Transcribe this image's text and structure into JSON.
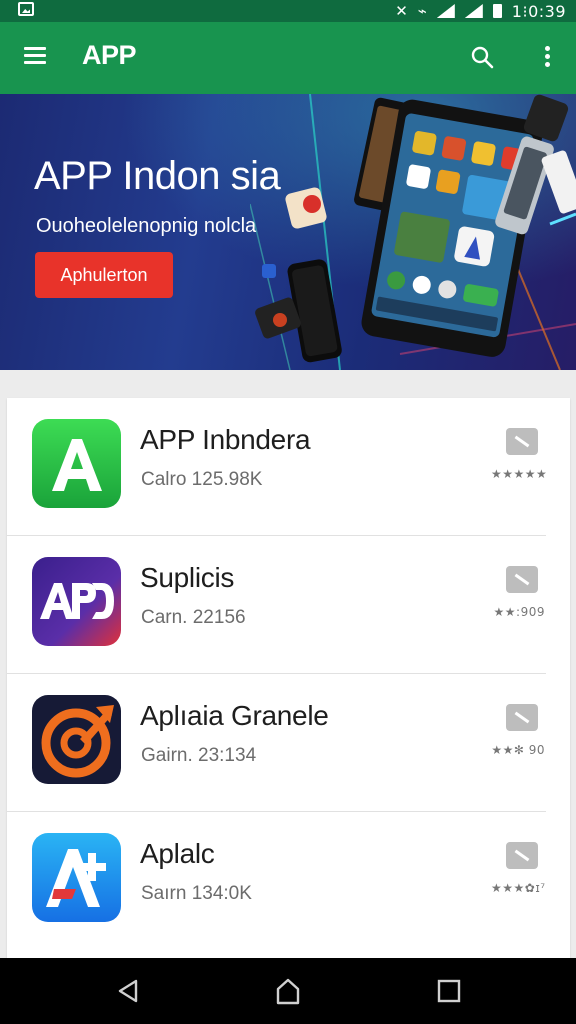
{
  "status_bar": {
    "time": "1⁝0:39"
  },
  "app_bar": {
    "title": "APP",
    "menu_icon": "menu-icon",
    "search_icon": "search-icon",
    "more_icon": "more-vert-icon"
  },
  "banner": {
    "title": "APP Indon sia",
    "subtitle": "Ouoheolelenopnig nolcla",
    "button_label": "Aphulerton",
    "button_color": "#e8332a"
  },
  "apps": [
    {
      "name": "APP Inbndera",
      "meta": "Calro 125.98K",
      "rating": "★★★★★",
      "icon": "letter-a-icon"
    },
    {
      "name": "Suplicis",
      "meta": "Carn. 22156",
      "rating": "★★:909",
      "icon": "apd-logo-icon"
    },
    {
      "name": "Aplıaia Granele",
      "meta": "Gairn. 23:134",
      "rating": "★★✻ 90",
      "icon": "target-icon"
    },
    {
      "name": "Aplalc",
      "meta": "Saırn 134:0K",
      "rating": "★★★✿ɪ⁷",
      "icon": "app-store-a-icon"
    }
  ],
  "colors": {
    "status_bar": "#0f6b3f",
    "app_bar": "#18944f",
    "list_bg": "#ffffff"
  }
}
